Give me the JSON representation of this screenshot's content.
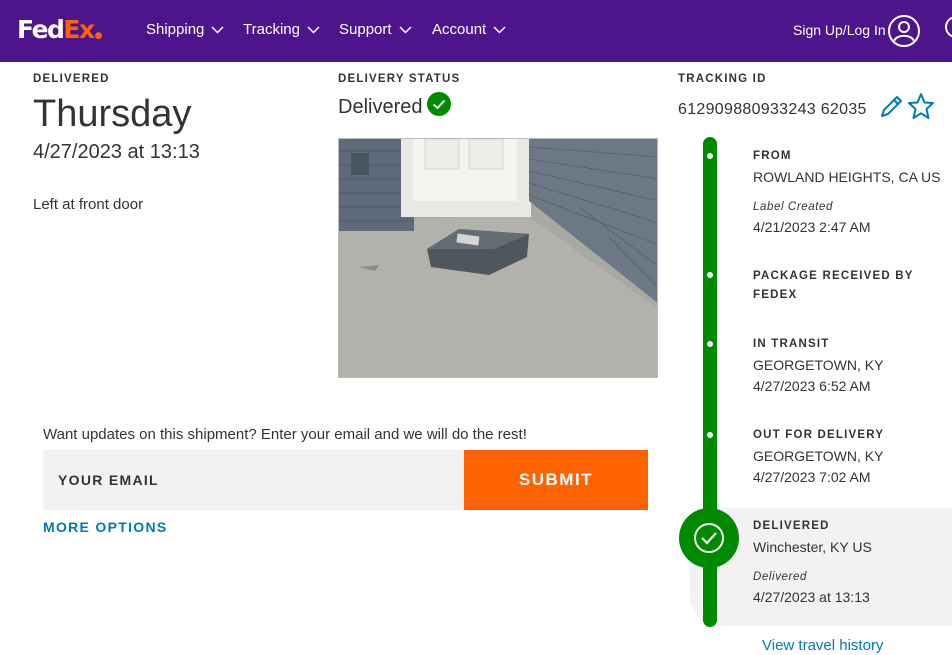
{
  "header": {
    "logo_fed": "Fed",
    "logo_ex": "Ex",
    "nav": [
      "Shipping",
      "Tracking",
      "Support",
      "Account"
    ],
    "signin": "Sign Up/Log In"
  },
  "delivered": {
    "label": "DELIVERED",
    "day": "Thursday",
    "datetime": "4/27/2023 at 13:13",
    "note": "Left at front door"
  },
  "status": {
    "label": "DELIVERY STATUS",
    "value": "Delivered"
  },
  "tracking": {
    "label": "TRACKING ID",
    "number": "612909880933243 62035"
  },
  "updates": {
    "text": "Want updates on this shipment? Enter your email and we will do the rest!",
    "email_placeholder": "YOUR EMAIL",
    "submit": "SUBMIT",
    "more_options": "MORE OPTIONS"
  },
  "timeline": {
    "from": {
      "title": "FROM",
      "location": "ROWLAND HEIGHTS, CA US",
      "sub": "Label Created",
      "time": "4/21/2023 2:47 AM"
    },
    "received": {
      "title1": "PACKAGE RECEIVED BY",
      "title2": "FEDEX"
    },
    "transit": {
      "title": "IN TRANSIT",
      "location": "GEORGETOWN, KY",
      "time": "4/27/2023 6:52 AM"
    },
    "out": {
      "title": "OUT FOR DELIVERY",
      "location": "GEORGETOWN, KY",
      "time": "4/27/2023 7:02 AM"
    },
    "delivered": {
      "title": "DELIVERED",
      "location": "Winchester, KY US",
      "sub": "Delivered",
      "time": "4/27/2023 at 13:13"
    }
  },
  "view_history": "View travel history",
  "colors": {
    "purple": "#4d148c",
    "orange": "#ff6200",
    "green": "#008a00",
    "link": "#007ab7"
  }
}
